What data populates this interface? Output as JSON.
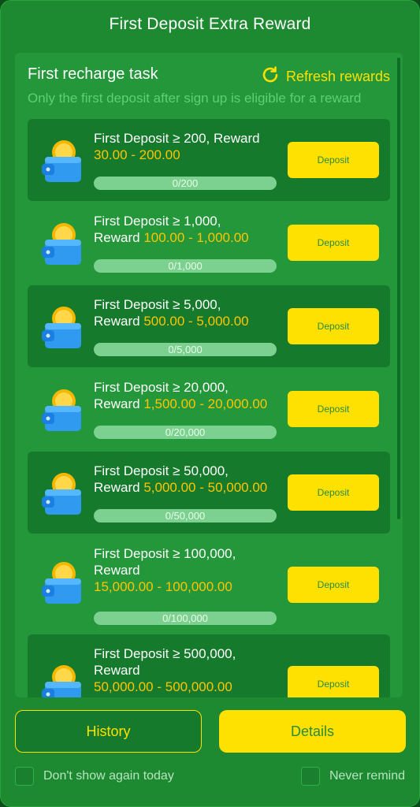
{
  "dialog": {
    "title": "First Deposit Extra Reward"
  },
  "panel": {
    "heading": "First recharge task",
    "refresh_label": "Refresh rewards",
    "subtitle": "Only the first deposit after sign up is eligible for a reward"
  },
  "tasks": [
    {
      "line1": "First Deposit ≥ 200, Reward",
      "line2": "",
      "amount": "30.00 - 200.00",
      "progress": "0/200",
      "button": "Deposit"
    },
    {
      "line1": "First Deposit ≥ 1,000,",
      "line2": "Reward",
      "amount": "100.00 - 1,000.00",
      "progress": "0/1,000",
      "button": "Deposit"
    },
    {
      "line1": "First Deposit ≥ 5,000,",
      "line2": "Reward",
      "amount": "500.00 - 5,000.00",
      "progress": "0/5,000",
      "button": "Deposit"
    },
    {
      "line1": "First Deposit ≥ 20,000,",
      "line2": "Reward",
      "amount": "1,500.00 - 20,000.00",
      "progress": "0/20,000",
      "button": "Deposit"
    },
    {
      "line1": "First Deposit ≥ 50,000,",
      "line2": "Reward",
      "amount": "5,000.00 - 50,000.00",
      "progress": "0/50,000",
      "button": "Deposit"
    },
    {
      "line1": "First Deposit ≥ 100,000,",
      "line2": "Reward",
      "amount": "15,000.00 - 100,000.00",
      "progress": "0/100,000",
      "button": "Deposit"
    },
    {
      "line1": "First Deposit ≥ 500,000,",
      "line2": "Reward",
      "amount": "50,000.00 - 500,000.00",
      "progress": "",
      "button": "Deposit"
    }
  ],
  "footer": {
    "history_label": "History",
    "details_label": "Details",
    "dont_show_label": "Don't show again today",
    "never_remind_label": "Never remind"
  },
  "colors": {
    "accent": "#ffe100",
    "amount": "#ffc400",
    "background": "#1d8a31"
  }
}
